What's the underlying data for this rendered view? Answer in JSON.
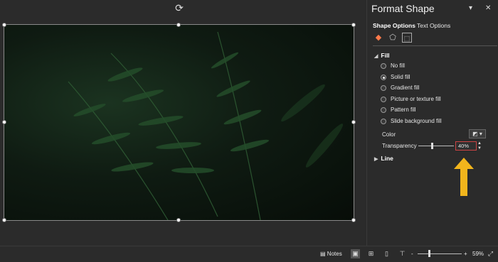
{
  "pane": {
    "title": "Format Shape",
    "dropdown_icon": "chevron-down-icon",
    "close_icon": "close-icon",
    "tabs": [
      "Shape Options",
      "Text Options"
    ],
    "icon_tabs": [
      "fill-line-icon",
      "effects-pentagon-icon",
      "size-properties-icon"
    ]
  },
  "fill": {
    "section_label": "Fill",
    "options": [
      {
        "label": "No fill",
        "checked": false
      },
      {
        "label": "Solid fill",
        "checked": true
      },
      {
        "label": "Gradient fill",
        "checked": false
      },
      {
        "label": "Picture or texture fill",
        "checked": false
      },
      {
        "label": "Pattern fill",
        "checked": false
      },
      {
        "label": "Slide background fill",
        "checked": false
      }
    ],
    "color_label": "Color",
    "transparency_label": "Transparency",
    "transparency_value": "40%",
    "transparency_level": 0.4
  },
  "line": {
    "section_label": "Line"
  },
  "statusbar": {
    "notes_label": "Notes",
    "zoom_minus": "-",
    "zoom_plus": "+",
    "zoom_level": "59%",
    "zoom_fraction": 0.59
  },
  "colors": {
    "arrow": "#f2b51c",
    "accent": "#ff7a4a"
  }
}
